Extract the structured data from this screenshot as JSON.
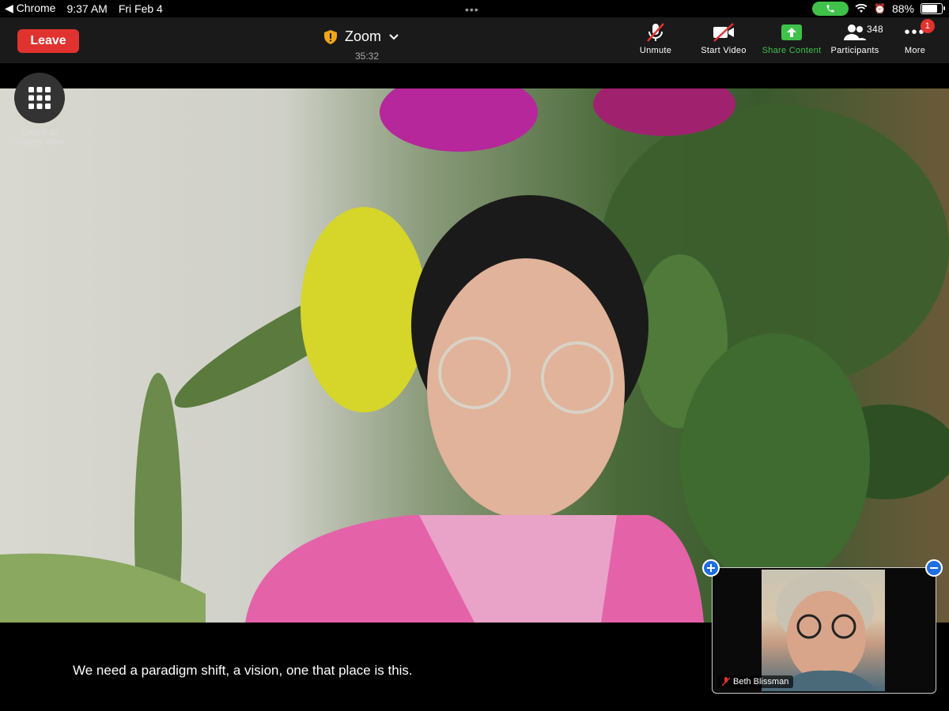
{
  "status": {
    "back_app": "Chrome",
    "time": "9:37 AM",
    "date": "Fri Feb 4",
    "battery": "88%",
    "battery_level": 0.88
  },
  "toolbar": {
    "leave_label": "Leave",
    "meeting_title": "Zoom",
    "timer": "35:32",
    "unmute_label": "Unmute",
    "start_video_label": "Start Video",
    "share_label": "Share Content",
    "participants_label": "Participants",
    "participants_count": "348",
    "more_label": "More",
    "more_badge": "1"
  },
  "gallery": {
    "label_line1": "Switch to",
    "label_line2": "Gallery View"
  },
  "caption": "We need a paradigm shift, a vision, one that place is this.",
  "self_view": {
    "name": "Beth Blissman"
  },
  "colors": {
    "leave": "#e0322e",
    "share": "#3ec24a",
    "accent": "#1f6fe0"
  }
}
